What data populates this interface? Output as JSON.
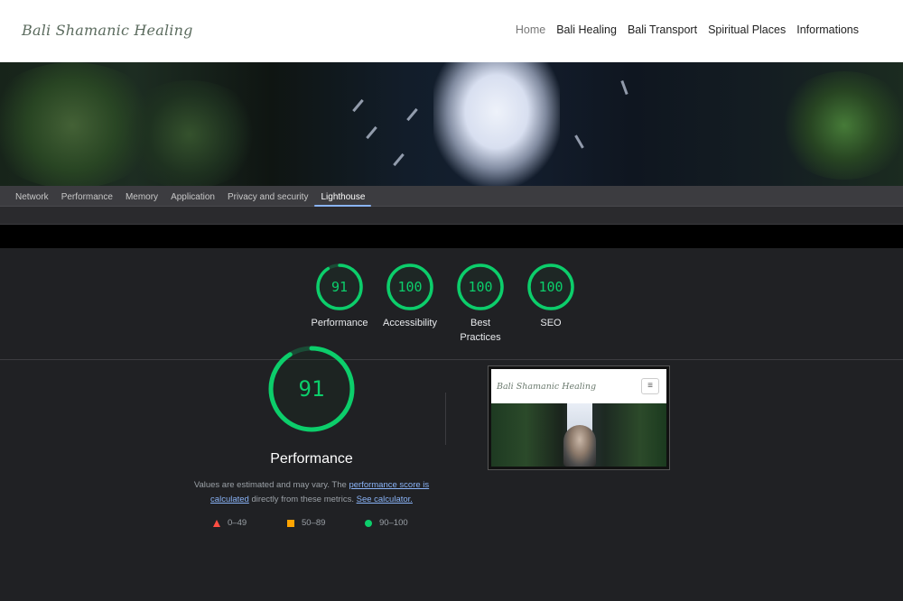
{
  "site": {
    "logo": "Bali Shamanic Healing",
    "nav": [
      {
        "label": "Home",
        "active": true
      },
      {
        "label": "Bali Healing",
        "active": false
      },
      {
        "label": "Bali Transport",
        "active": false
      },
      {
        "label": "Spiritual Places",
        "active": false
      },
      {
        "label": "Informations",
        "active": false
      }
    ]
  },
  "devtools": {
    "tabs": [
      {
        "label": "Network"
      },
      {
        "label": "Performance"
      },
      {
        "label": "Memory"
      },
      {
        "label": "Application"
      },
      {
        "label": "Privacy and security"
      },
      {
        "label": "Lighthouse",
        "active": true
      }
    ]
  },
  "lighthouse": {
    "scores": [
      {
        "label": "Performance",
        "value": 91
      },
      {
        "label": "Accessibility",
        "value": 100
      },
      {
        "label": "Best Practices",
        "value": 100
      },
      {
        "label": "SEO",
        "value": 100
      }
    ],
    "colors": {
      "pass": "#0cce6b",
      "average": "#ffa400",
      "fail": "#ff4e42",
      "pass_bg": "#0f3a22"
    },
    "main": {
      "score": 91,
      "title": "Performance",
      "desc_part1": "Values are estimated and may vary. The",
      "desc_link1": "performance score is calculated",
      "desc_part2": "directly from these metrics.",
      "desc_link2": "See calculator."
    },
    "legend": [
      {
        "label": "0–49",
        "icon": "triangle-icon"
      },
      {
        "label": "50–89",
        "icon": "square-icon"
      },
      {
        "label": "90–100",
        "icon": "circle-icon"
      }
    ],
    "thumbnail": {
      "logo": "Bali Shamanic Healing",
      "menu_glyph": "≡"
    }
  }
}
